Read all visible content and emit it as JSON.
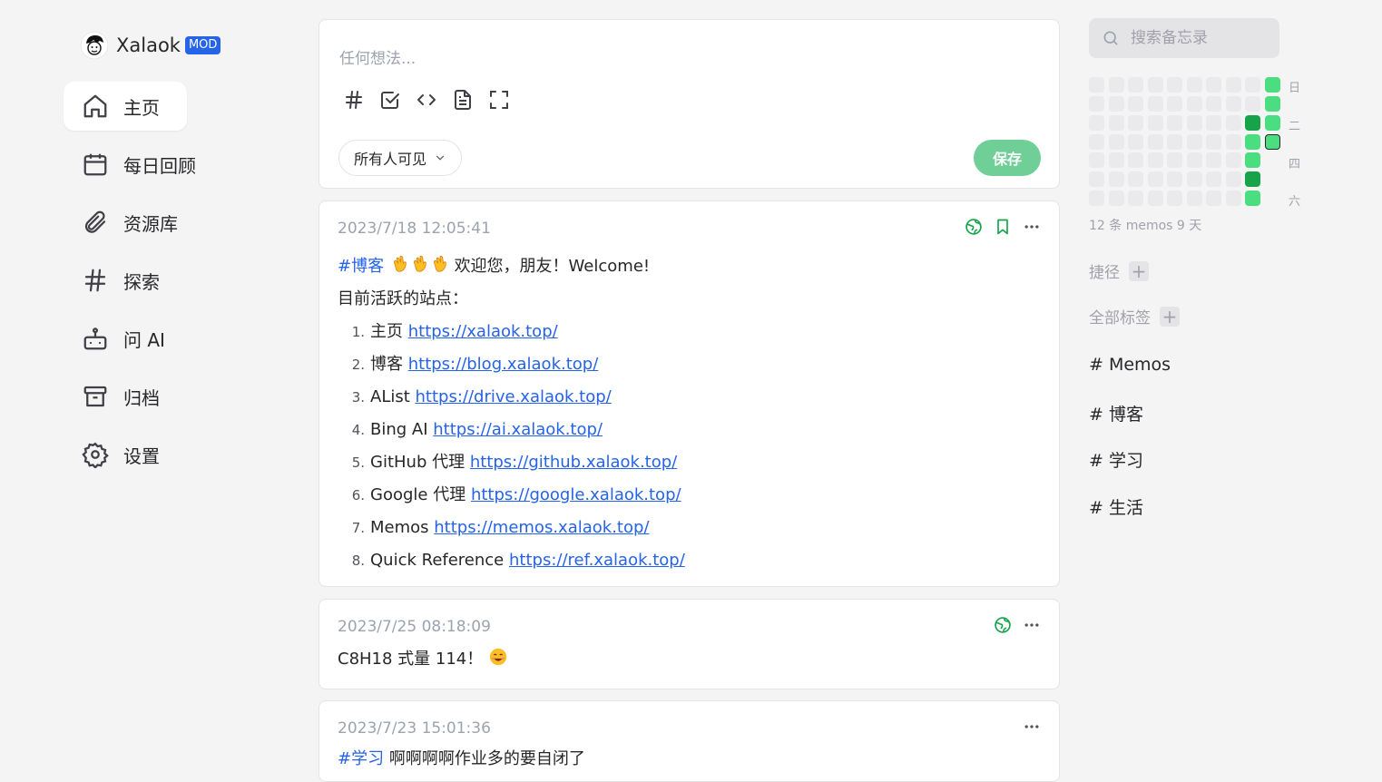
{
  "brand": {
    "name": "Xalaok",
    "badge": "MOD"
  },
  "nav": {
    "items": [
      {
        "label": "主页",
        "icon": "home-icon",
        "active": true
      },
      {
        "label": "每日回顾",
        "icon": "calendar-icon"
      },
      {
        "label": "资源库",
        "icon": "paperclip-icon"
      },
      {
        "label": "探索",
        "icon": "hash-icon"
      },
      {
        "label": "问 AI",
        "icon": "robot-icon"
      },
      {
        "label": "归档",
        "icon": "archive-icon"
      },
      {
        "label": "设置",
        "icon": "gear-icon"
      }
    ]
  },
  "editor": {
    "placeholder": "任何想法...",
    "tools": [
      "hash-icon",
      "checkbox-icon",
      "code-icon",
      "file-icon",
      "fullscreen-icon"
    ],
    "visibility": "所有人可见",
    "save": "保存"
  },
  "memos": [
    {
      "time": "2023/7/18 12:05:41",
      "tag": "#博客",
      "greeting": "欢迎您，朋友！Welcome!",
      "subtitle": "目前活跃的站点：",
      "sites": [
        {
          "num": "1.",
          "name": "主页",
          "url": "https://xalaok.top/"
        },
        {
          "num": "2.",
          "name": "博客",
          "url": "https://blog.xalaok.top/"
        },
        {
          "num": "3.",
          "name": "AList",
          "url": "https://drive.xalaok.top/"
        },
        {
          "num": "4.",
          "name": "Bing AI",
          "url": "https://ai.xalaok.top/"
        },
        {
          "num": "5.",
          "name": "GitHub 代理",
          "url": "https://github.xalaok.top/"
        },
        {
          "num": "6.",
          "name": "Google 代理",
          "url": "https://google.xalaok.top/"
        },
        {
          "num": "7.",
          "name": "Memos",
          "url": "https://memos.xalaok.top/"
        },
        {
          "num": "8.",
          "name": "Quick Reference",
          "url": "https://ref.xalaok.top/"
        }
      ]
    },
    {
      "time": "2023/7/25 08:18:09",
      "content": "C8H18 式量 114！"
    },
    {
      "time": "2023/7/23 15:01:36",
      "tag": "#学习",
      "content": "啊啊啊啊作业多的要自闭了"
    }
  ],
  "sidebar": {
    "search_placeholder": "搜索备忘录",
    "weekdays": [
      "日",
      "二",
      "四",
      "六"
    ],
    "stats": "12 条 memos 9 天",
    "shortcuts": "捷径",
    "all_tags": "全部标签",
    "tags": [
      "# Memos",
      "# 博客",
      "# 学习",
      "# 生活"
    ]
  },
  "colors": {
    "accent": "#2563eb",
    "save_button": "#6fcf97",
    "heat_light": "#4ade80",
    "heat_dark": "#16a34a",
    "heat_empty": "#eaeaec"
  }
}
